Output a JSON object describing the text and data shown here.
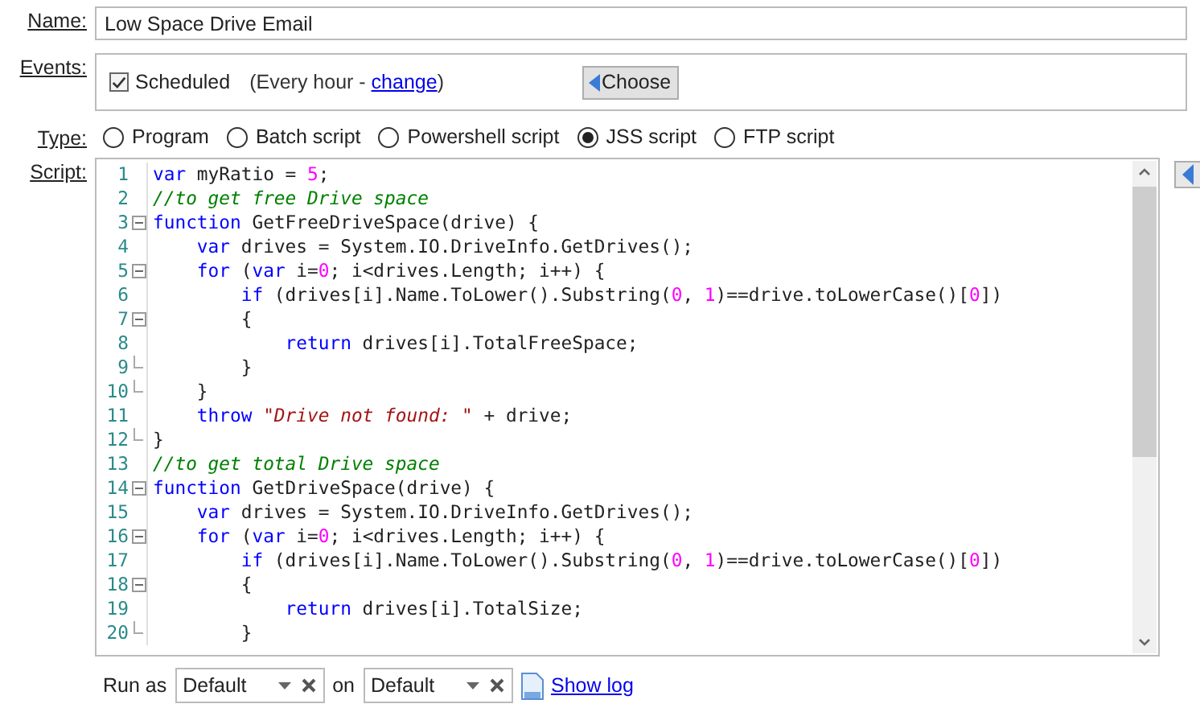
{
  "name": {
    "label": "Name:",
    "value": "Low Space Drive Email"
  },
  "events": {
    "label": "Events:",
    "scheduled": {
      "label": "Scheduled",
      "checked": true
    },
    "schedule_prefix": "(Every hour - ",
    "schedule_link": "change",
    "schedule_suffix": ")",
    "choose_button": "Choose"
  },
  "type": {
    "label": "Type:",
    "options": [
      {
        "label": "Program",
        "selected": false
      },
      {
        "label": "Batch script",
        "selected": false
      },
      {
        "label": "Powershell script",
        "selected": false
      },
      {
        "label": "JSS script",
        "selected": true
      },
      {
        "label": "FTP script",
        "selected": false
      }
    ]
  },
  "script": {
    "label": "Script:",
    "lines": [
      {
        "number": "1",
        "collapsible": false,
        "block_end": false,
        "tokens": [
          {
            "kind": "keyword",
            "text": "var"
          },
          {
            "kind": "plain",
            "text": " myRatio = "
          },
          {
            "kind": "number",
            "text": "5"
          },
          {
            "kind": "plain",
            "text": ";"
          }
        ]
      },
      {
        "number": "2",
        "collapsible": false,
        "block_end": false,
        "tokens": [
          {
            "kind": "comment",
            "text": "//to get free Drive space"
          }
        ]
      },
      {
        "number": "3",
        "collapsible": true,
        "block_end": false,
        "tokens": [
          {
            "kind": "keyword",
            "text": "function"
          },
          {
            "kind": "plain",
            "text": " GetFreeDriveSpace(drive) {"
          }
        ]
      },
      {
        "number": "4",
        "collapsible": false,
        "block_end": false,
        "tokens": [
          {
            "kind": "keyword",
            "text": "    var"
          },
          {
            "kind": "plain",
            "text": " drives = System.IO.DriveInfo.GetDrives();"
          }
        ]
      },
      {
        "number": "5",
        "collapsible": true,
        "block_end": false,
        "tokens": [
          {
            "kind": "keyword",
            "text": "    for"
          },
          {
            "kind": "plain",
            "text": " ("
          },
          {
            "kind": "keyword",
            "text": "var"
          },
          {
            "kind": "plain",
            "text": " i="
          },
          {
            "kind": "number",
            "text": "0"
          },
          {
            "kind": "plain",
            "text": "; i<drives.Length; i++) {"
          }
        ]
      },
      {
        "number": "6",
        "collapsible": false,
        "block_end": false,
        "tokens": [
          {
            "kind": "keyword",
            "text": "        if"
          },
          {
            "kind": "plain",
            "text": " (drives[i].Name.ToLower().Substring("
          },
          {
            "kind": "number",
            "text": "0"
          },
          {
            "kind": "plain",
            "text": ", "
          },
          {
            "kind": "number",
            "text": "1"
          },
          {
            "kind": "plain",
            "text": ")==drive.toLowerCase()["
          },
          {
            "kind": "number",
            "text": "0"
          },
          {
            "kind": "plain",
            "text": "])"
          }
        ]
      },
      {
        "number": "7",
        "collapsible": true,
        "block_end": false,
        "tokens": [
          {
            "kind": "plain",
            "text": "        {"
          }
        ]
      },
      {
        "number": "8",
        "collapsible": false,
        "block_end": false,
        "tokens": [
          {
            "kind": "keyword",
            "text": "            return"
          },
          {
            "kind": "plain",
            "text": " drives[i].TotalFreeSpace;"
          }
        ]
      },
      {
        "number": "9",
        "collapsible": false,
        "block_end": true,
        "tokens": [
          {
            "kind": "plain",
            "text": "        }"
          }
        ]
      },
      {
        "number": "10",
        "collapsible": false,
        "block_end": true,
        "tokens": [
          {
            "kind": "plain",
            "text": "    }"
          }
        ]
      },
      {
        "number": "11",
        "collapsible": false,
        "block_end": false,
        "tokens": [
          {
            "kind": "keyword",
            "text": "    throw "
          },
          {
            "kind": "string",
            "text": "\"Drive not found: \""
          },
          {
            "kind": "plain",
            "text": " + drive;"
          }
        ]
      },
      {
        "number": "12",
        "collapsible": false,
        "block_end": true,
        "tokens": [
          {
            "kind": "plain",
            "text": "}"
          }
        ]
      },
      {
        "number": "13",
        "collapsible": false,
        "block_end": false,
        "tokens": [
          {
            "kind": "comment",
            "text": "//to get total Drive space"
          }
        ]
      },
      {
        "number": "14",
        "collapsible": true,
        "block_end": false,
        "tokens": [
          {
            "kind": "keyword",
            "text": "function"
          },
          {
            "kind": "plain",
            "text": " GetDriveSpace(drive) {"
          }
        ]
      },
      {
        "number": "15",
        "collapsible": false,
        "block_end": false,
        "tokens": [
          {
            "kind": "keyword",
            "text": "    var"
          },
          {
            "kind": "plain",
            "text": " drives = System.IO.DriveInfo.GetDrives();"
          }
        ]
      },
      {
        "number": "16",
        "collapsible": true,
        "block_end": false,
        "tokens": [
          {
            "kind": "keyword",
            "text": "    for"
          },
          {
            "kind": "plain",
            "text": " ("
          },
          {
            "kind": "keyword",
            "text": "var"
          },
          {
            "kind": "plain",
            "text": " i="
          },
          {
            "kind": "number",
            "text": "0"
          },
          {
            "kind": "plain",
            "text": "; i<drives.Length; i++) {"
          }
        ]
      },
      {
        "number": "17",
        "collapsible": false,
        "block_end": false,
        "tokens": [
          {
            "kind": "keyword",
            "text": "        if"
          },
          {
            "kind": "plain",
            "text": " (drives[i].Name.ToLower().Substring("
          },
          {
            "kind": "number",
            "text": "0"
          },
          {
            "kind": "plain",
            "text": ", "
          },
          {
            "kind": "number",
            "text": "1"
          },
          {
            "kind": "plain",
            "text": ")==drive.toLowerCase()["
          },
          {
            "kind": "number",
            "text": "0"
          },
          {
            "kind": "plain",
            "text": "])"
          }
        ]
      },
      {
        "number": "18",
        "collapsible": true,
        "block_end": false,
        "tokens": [
          {
            "kind": "plain",
            "text": "        {"
          }
        ]
      },
      {
        "number": "19",
        "collapsible": false,
        "block_end": false,
        "tokens": [
          {
            "kind": "keyword",
            "text": "            return"
          },
          {
            "kind": "plain",
            "text": " drives[i].TotalSize;"
          }
        ]
      },
      {
        "number": "20",
        "collapsible": false,
        "block_end": true,
        "tokens": [
          {
            "kind": "plain",
            "text": "        }"
          }
        ]
      }
    ]
  },
  "run_as": {
    "label": "Run as",
    "user": "Default",
    "on_label": "on",
    "host": "Default",
    "log_link": "Show log"
  }
}
